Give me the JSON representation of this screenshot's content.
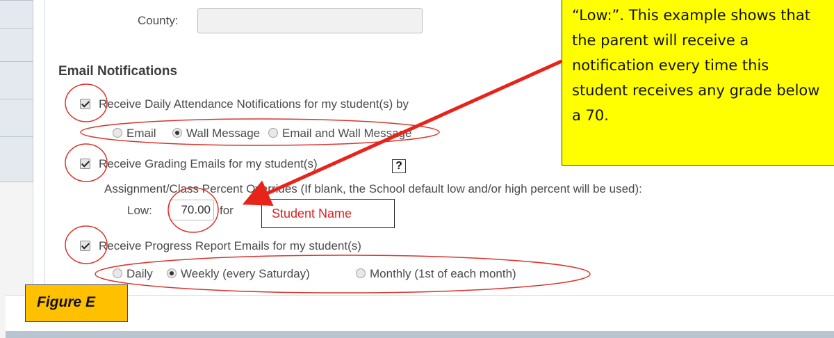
{
  "form": {
    "county_label": "County:",
    "county_value": "",
    "section_title": "Email Notifications",
    "attendance": {
      "checked": true,
      "label": "Receive Daily Attendance Notifications for my student(s) by",
      "options": [
        "Email",
        "Wall Message",
        "Email and Wall Message"
      ],
      "selected": "Wall Message"
    },
    "grading": {
      "checked": true,
      "label": "Receive Grading Emails for my student(s)",
      "help_glyph": "?",
      "overrides_label": "Assignment/Class Percent Overrides (If blank, the School default low and/or high percent will be used):",
      "low_label": "Low:",
      "low_value": "70.00",
      "for_text": "for",
      "student_name": "Student Name"
    },
    "progress": {
      "checked": true,
      "label": "Receive Progress Report Emails for my student(s)",
      "options": [
        "Daily",
        "Weekly (every Saturday)",
        "Monthly (1st of each month)"
      ],
      "selected": "Weekly (every Saturday)"
    }
  },
  "annotation": {
    "callout_lines": [
      "“Low:”.  This example shows that",
      "the parent will receive a",
      "notification every time this",
      "student receives any grade below",
      "a 70."
    ],
    "figure_label": "Figure E",
    "arrow_color": "#e8231a",
    "circle_color": "#d9342b",
    "callout_color": "#ffff00",
    "figure_label_color": "#ffc000"
  },
  "icons": {
    "checkbox": "checkbox-checked-icon",
    "radio_selected": "radio-selected-icon",
    "radio_unselected": "radio-unselected-icon",
    "help": "question-mark-icon"
  }
}
